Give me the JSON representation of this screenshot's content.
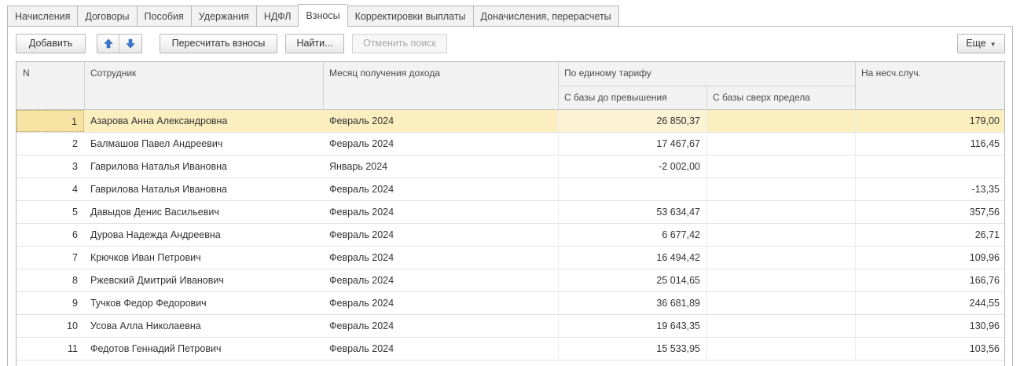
{
  "tabs": [
    {
      "label": "Начисления",
      "active": false
    },
    {
      "label": "Договоры",
      "active": false
    },
    {
      "label": "Пособия",
      "active": false
    },
    {
      "label": "Удержания",
      "active": false
    },
    {
      "label": "НДФЛ",
      "active": false
    },
    {
      "label": "Взносы",
      "active": true
    },
    {
      "label": "Корректировки выплаты",
      "active": false
    },
    {
      "label": "Доначисления, перерасчеты",
      "active": false
    }
  ],
  "toolbar": {
    "add_label": "Добавить",
    "move_up_icon": "arrow-up-icon",
    "move_down_icon": "arrow-down-icon",
    "recalc_label": "Пересчитать взносы",
    "find_label": "Найти...",
    "cancel_search_label": "Отменить поиск",
    "more_label": "Еще",
    "accent_color": "#3a7ad0"
  },
  "table": {
    "headers": {
      "n": "N",
      "employee": "Сотрудник",
      "month": "Месяц получения дохода",
      "single_tariff": "По единому тарифу",
      "base_below": "С базы до превышения",
      "base_over": "С базы сверх предела",
      "accident": "На несч.случ."
    },
    "selected_color": "#fbefc0",
    "rows": [
      {
        "n": "1",
        "employee": "Азарова Анна Александровна",
        "month": "Февраль 2024",
        "base_below": "26 850,37",
        "base_over": "",
        "accident": "179,00",
        "selected": true
      },
      {
        "n": "2",
        "employee": "Балмашов Павел Андреевич",
        "month": "Февраль 2024",
        "base_below": "17 467,67",
        "base_over": "",
        "accident": "116,45",
        "selected": false
      },
      {
        "n": "3",
        "employee": "Гаврилова Наталья Ивановна",
        "month": "Январь 2024",
        "base_below": "-2 002,00",
        "base_over": "",
        "accident": "",
        "selected": false
      },
      {
        "n": "4",
        "employee": "Гаврилова Наталья Ивановна",
        "month": "Февраль 2024",
        "base_below": "",
        "base_over": "",
        "accident": "-13,35",
        "selected": false
      },
      {
        "n": "5",
        "employee": "Давыдов Денис Васильевич",
        "month": "Февраль 2024",
        "base_below": "53 634,47",
        "base_over": "",
        "accident": "357,56",
        "selected": false
      },
      {
        "n": "6",
        "employee": "Дурова Надежда Андреевна",
        "month": "Февраль 2024",
        "base_below": "6 677,42",
        "base_over": "",
        "accident": "26,71",
        "selected": false
      },
      {
        "n": "7",
        "employee": "Крючков Иван Петрович",
        "month": "Февраль 2024",
        "base_below": "16 494,42",
        "base_over": "",
        "accident": "109,96",
        "selected": false
      },
      {
        "n": "8",
        "employee": "Ржевский Дмитрий Иванович",
        "month": "Февраль 2024",
        "base_below": "25 014,65",
        "base_over": "",
        "accident": "166,76",
        "selected": false
      },
      {
        "n": "9",
        "employee": "Тучков Федор Федорович",
        "month": "Февраль 2024",
        "base_below": "36 681,89",
        "base_over": "",
        "accident": "244,55",
        "selected": false
      },
      {
        "n": "10",
        "employee": "Усова Алла Николаевна",
        "month": "Февраль 2024",
        "base_below": "19 643,35",
        "base_over": "",
        "accident": "130,96",
        "selected": false
      },
      {
        "n": "11",
        "employee": "Федотов Геннадий Петрович",
        "month": "Февраль 2024",
        "base_below": "15 533,95",
        "base_over": "",
        "accident": "103,56",
        "selected": false
      }
    ]
  }
}
